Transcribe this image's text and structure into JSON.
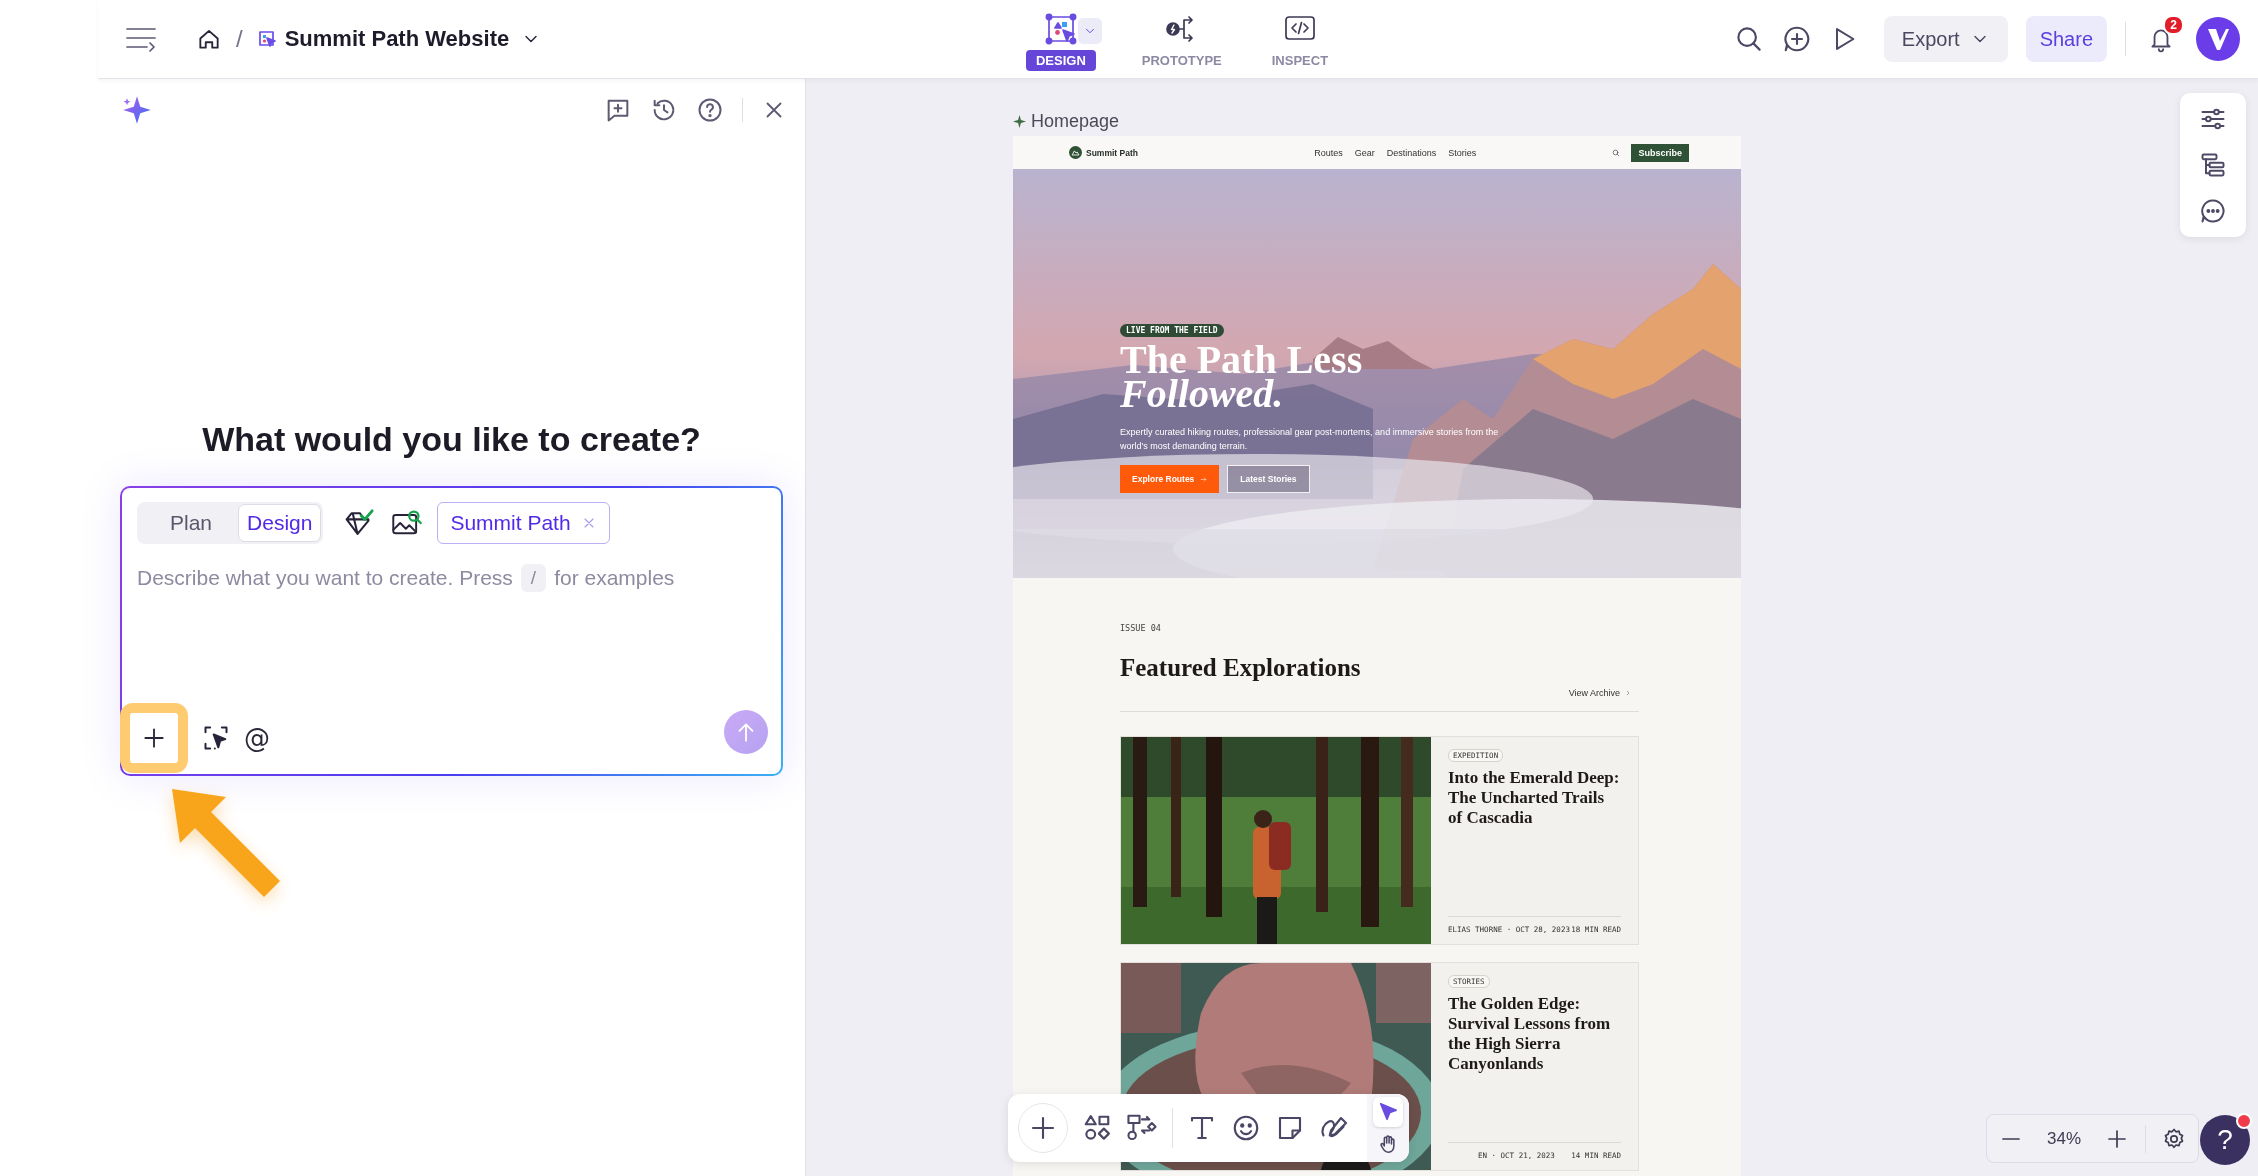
{
  "topbar": {
    "breadcrumb_separator": "/",
    "project": "Summit Path Website",
    "modes": [
      {
        "label": "DESIGN",
        "kind": "design",
        "selected": true
      },
      {
        "label": "PROTOTYPE",
        "kind": "prototype",
        "selected": false
      },
      {
        "label": "INSPECT",
        "kind": "inspect",
        "selected": false
      }
    ],
    "export": "Export",
    "share": "Share",
    "notifications": "2"
  },
  "assistant": {
    "heading": "What would you like to create?",
    "modes": [
      {
        "label": "Plan",
        "selected": false
      },
      {
        "label": "Design",
        "selected": true
      }
    ],
    "context_chip": "Summit Path",
    "placeholder": "Describe what you want to create. Press",
    "key_hint": "/",
    "placeholder_end": "for examples",
    "mention": "@"
  },
  "canvas": {
    "frame_label": "Homepage",
    "zoom": "34%",
    "help": "?",
    "tools": [
      {
        "kind": "select",
        "selected": true
      },
      {
        "kind": "hand",
        "selected": false
      }
    ]
  },
  "site": {
    "brand": "Summit Path",
    "nav": [
      "Routes",
      "Gear",
      "Destinations",
      "Stories"
    ],
    "subscribe": "Subscribe",
    "hero": {
      "badge": "LIVE FROM THE FIELD",
      "title_lines": [
        "The Path Less",
        "*Followed.*"
      ],
      "subtitle": "Expertly curated hiking routes, professional gear post-mortems, and immersive stories from the world's most demanding terrain.",
      "primary": "Explore Routes",
      "secondary": "Latest Stories"
    },
    "section": {
      "eyebrow": "ISSUE 04",
      "title": "Featured Explorations",
      "link": "View Archive"
    },
    "articles": [
      {
        "tag": "EXPEDITION",
        "title": "Into the Emerald Deep: The Uncharted Trails of Cascadia",
        "byline": "ELIAS THORNE · OCT 28, 2023",
        "read": "18 MIN READ"
      },
      {
        "tag": "STORIES",
        "title": "The Golden Edge: Survival Lessons from the High Sierra Canyonlands",
        "byline": "EN · OCT 21, 2023",
        "read": "14 MIN READ"
      }
    ]
  }
}
